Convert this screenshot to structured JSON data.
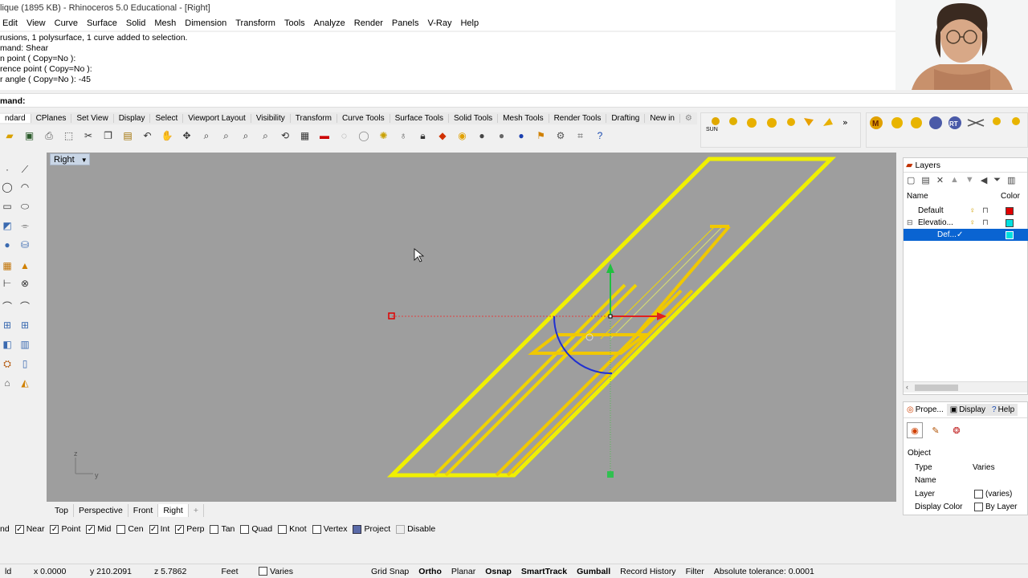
{
  "window": {
    "title": "lique (1895 KB) - Rhinoceros 5.0 Educational - [Right]"
  },
  "menu": [
    "Edit",
    "View",
    "Curve",
    "Surface",
    "Solid",
    "Mesh",
    "Dimension",
    "Transform",
    "Tools",
    "Analyze",
    "Render",
    "Panels",
    "V-Ray",
    "Help"
  ],
  "command_history": [
    "rusions, 1 polysurface, 1 curve added to selection.",
    "mand: Shear",
    "n point ( Copy=No ):",
    "rence point ( Copy=No ):",
    "r angle ( Copy=No ): -45"
  ],
  "command_prompt": "mand:",
  "toolbar_tabs": [
    "ndard",
    "CPlanes",
    "Set View",
    "Display",
    "Select",
    "Viewport Layout",
    "Visibility",
    "Transform",
    "Curve Tools",
    "Surface Tools",
    "Solid Tools",
    "Mesh Tools",
    "Render Tools",
    "Drafting",
    "New in"
  ],
  "toolbar_icons": [
    "open-icon",
    "save-icon",
    "print-icon",
    "import-icon",
    "cut-icon",
    "copy-icon",
    "paste-icon",
    "undo-icon",
    "pan-icon",
    "move-icon",
    "zoom-icon",
    "zoom-window-icon",
    "zoom-extents-icon",
    "zoom-selected-icon",
    "rotate-view-icon",
    "grid-icon",
    "car-icon",
    "select-icon",
    "point-icon",
    "light-icon",
    "lock-icon",
    "material-icon",
    "color-wheel-icon",
    "sphere-icon",
    "render-icon",
    "blue-sphere-icon",
    "flag-icon",
    "settings-icon",
    "options-icon",
    "help-icon"
  ],
  "render_toolbar_1": [
    "sun-icon",
    "light-icon",
    "sphere-icon",
    "sphere-icon",
    "sphere-icon",
    "flag-icon",
    "light-icon",
    "more-icon"
  ],
  "render_toolbar_1_labels": [
    "SUN"
  ],
  "render_toolbar_2": [
    "M",
    "RT"
  ],
  "viewport": {
    "label": "Right",
    "axis_z": "z",
    "axis_y": "y"
  },
  "viewport_tabs": [
    "Top",
    "Perspective",
    "Front",
    "Right",
    "+"
  ],
  "active_viewport_tab": "Right",
  "osnaps": [
    {
      "label": "nd",
      "state": "none"
    },
    {
      "label": "Near",
      "state": "checked"
    },
    {
      "label": "Point",
      "state": "checked"
    },
    {
      "label": "Mid",
      "state": "checked"
    },
    {
      "label": "Cen",
      "state": "unchecked"
    },
    {
      "label": "Int",
      "state": "checked"
    },
    {
      "label": "Perp",
      "state": "checked"
    },
    {
      "label": "Tan",
      "state": "unchecked"
    },
    {
      "label": "Quad",
      "state": "unchecked"
    },
    {
      "label": "Knot",
      "state": "unchecked"
    },
    {
      "label": "Vertex",
      "state": "unchecked"
    },
    {
      "label": "Project",
      "state": "blue"
    },
    {
      "label": "Disable",
      "state": "disabled"
    }
  ],
  "status": {
    "left": "ld",
    "x": "x 0.0000",
    "y": "y 210.2091",
    "z": "z 5.7862",
    "units": "Feet",
    "layer": "Varies",
    "grid_snap": "Grid Snap",
    "ortho": "Ortho",
    "planar": "Planar",
    "osnap": "Osnap",
    "smarttrack": "SmartTrack",
    "gumball": "Gumball",
    "record_history": "Record History",
    "filter": "Filter",
    "tolerance": "Absolute tolerance: 0.0001"
  },
  "layers": {
    "title": "Layers",
    "col_name": "Name",
    "col_color": "Color",
    "rows": [
      {
        "name": "Default",
        "color": "#e00000",
        "selected": false,
        "indent": 1
      },
      {
        "name": "Elevatio...",
        "color": "#00e0e0",
        "selected": false,
        "indent": 0
      },
      {
        "name": "Def...",
        "color": "#00e0e0",
        "selected": true,
        "indent": 2
      }
    ]
  },
  "properties": {
    "tabs": [
      "Prope...",
      "Display",
      "Help"
    ],
    "section": "Object",
    "rows": [
      {
        "label": "Type",
        "value": "Varies"
      },
      {
        "label": "Name",
        "value": ""
      },
      {
        "label": "Layer",
        "value": "(varies)"
      },
      {
        "label": "Display Color",
        "value": "By Layer"
      }
    ]
  },
  "colors": {
    "viewport_bg": "#9e9e9e",
    "geometry_yellow": "#f0f000",
    "geometry_orange": "#f0c800",
    "selection_blue": "#0a64d2"
  }
}
